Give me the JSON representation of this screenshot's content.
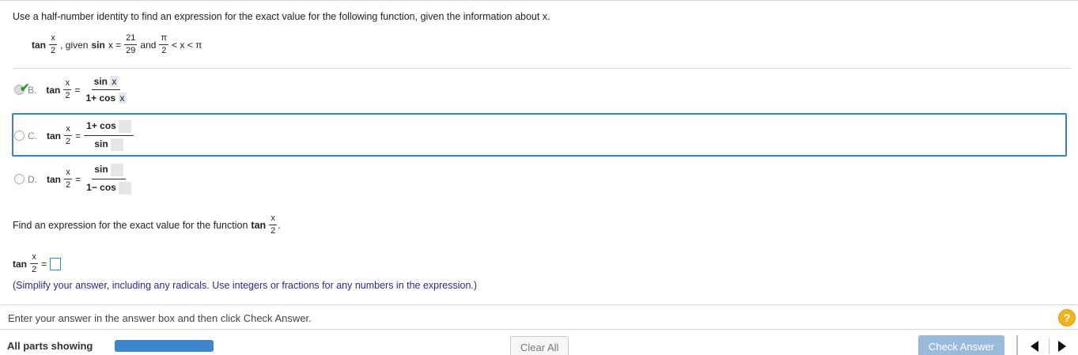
{
  "question": {
    "instruction": "Use a half-number identity to find an expression for the exact value for the following function, given the information about x.",
    "given": {
      "tan_label": "tan",
      "x": "x",
      "two": "2",
      "comma_text": ", given",
      "sin_label": "sin",
      "x_eq": "x =",
      "num21": "21",
      "den29": "29",
      "and_text": "and",
      "pi": "π",
      "pi_den": "2",
      "lt_x_lt": "< x < π"
    }
  },
  "options": [
    {
      "letter": "B.",
      "selected": true,
      "tan": "tan",
      "x": "x",
      "two": "2",
      "eq": "=",
      "num": "sin",
      "num_var": "x",
      "den": "1+ cos",
      "den_var": "x"
    },
    {
      "letter": "C.",
      "selected": false,
      "tan": "tan",
      "x": "x",
      "two": "2",
      "eq": "=",
      "num": "1+ cos",
      "den": "sin"
    },
    {
      "letter": "D.",
      "selected": false,
      "tan": "tan",
      "x": "x",
      "two": "2",
      "eq": "=",
      "num": "sin",
      "den": "1− cos"
    }
  ],
  "part2": {
    "prompt": "Find an expression for the exact value for the function",
    "tan": "tan",
    "x": "x",
    "two": "2",
    "period": ".",
    "answer_lhs": "tan",
    "eq": "=",
    "note": "(Simplify your answer, including any radicals. Use integers or fractions for any numbers in the expression.)"
  },
  "footer": {
    "hint": "Enter your answer in the answer box and then click Check Answer.",
    "help": "?",
    "parts_label": "All parts showing",
    "progress_fraction": 1.0,
    "clear_all": "Clear All",
    "check_answer": "Check Answer"
  },
  "colors": {
    "accent": "#3b7dc4",
    "progress": "#3d86cc",
    "check": "#2e9b2e",
    "help": "#f2b41c"
  }
}
